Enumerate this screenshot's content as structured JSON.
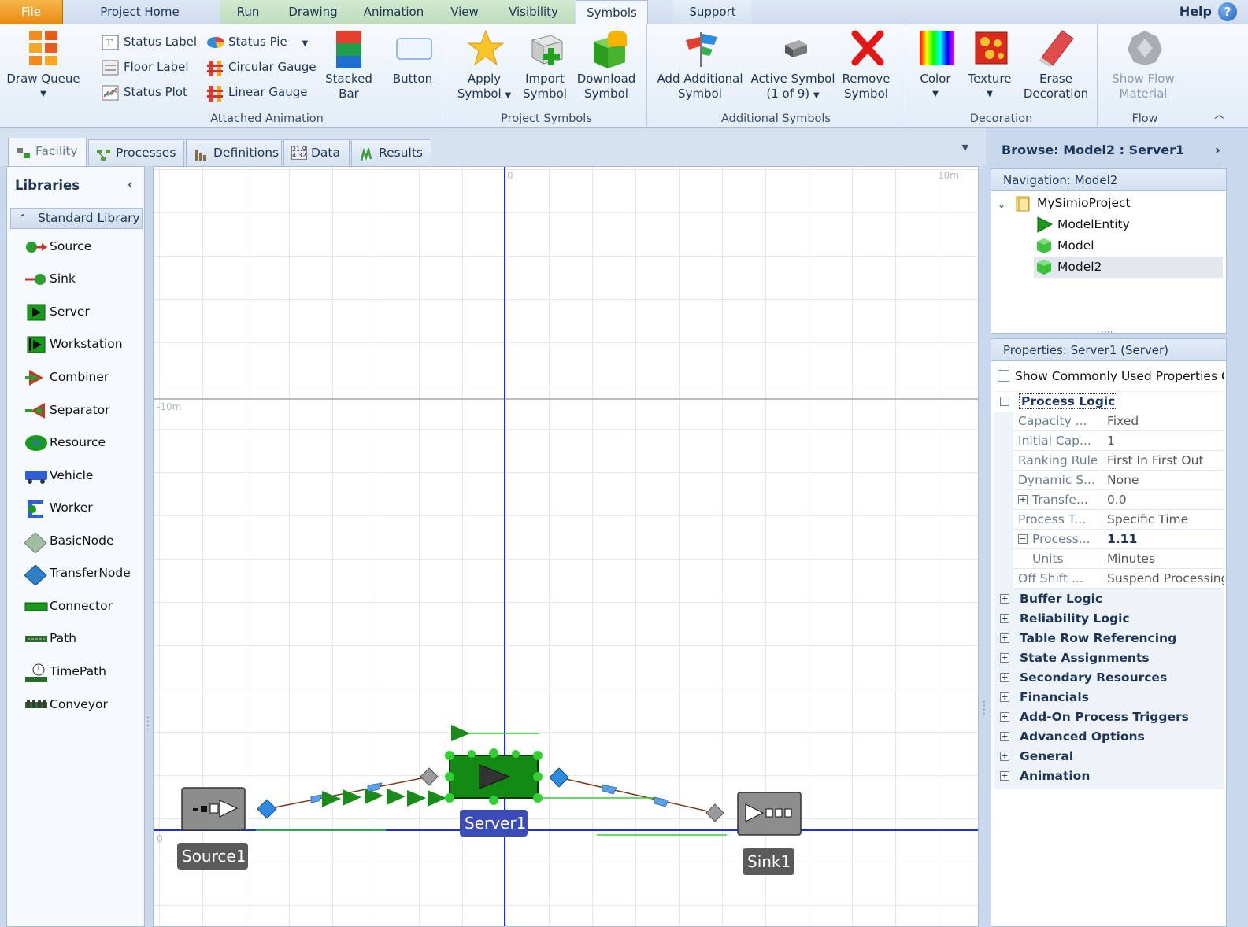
{
  "menu": {
    "file": "File",
    "tabs": [
      "Project Home",
      "Run",
      "Drawing",
      "Animation",
      "View",
      "Visibility",
      "Symbols",
      "Support"
    ],
    "active_tab": "Symbols",
    "help": "Help",
    "help_icon_glyph": "?"
  },
  "ribbon": {
    "draw_queue": {
      "label": "Draw Queue"
    },
    "attached_animation": {
      "label": "Attached Animation",
      "status_label": "Status Label",
      "floor_label": "Floor Label",
      "status_plot": "Status Plot",
      "status_pie": "Status Pie",
      "circular_gauge": "Circular Gauge",
      "linear_gauge": "Linear Gauge",
      "stacked_bar_l1": "Stacked",
      "stacked_bar_l2": "Bar",
      "button": "Button"
    },
    "project_symbols": {
      "label": "Project Symbols",
      "apply_l1": "Apply",
      "apply_l2": "Symbol",
      "import_l1": "Import",
      "import_l2": "Symbol",
      "download_l1": "Download",
      "download_l2": "Symbol"
    },
    "additional_symbols": {
      "label": "Additional Symbols",
      "add_l1": "Add Additional",
      "add_l2": "Symbol",
      "active_l1": "Active Symbol",
      "active_l2": "(1 of 9)",
      "remove_l1": "Remove",
      "remove_l2": "Symbol"
    },
    "decoration": {
      "label": "Decoration",
      "color": "Color",
      "texture": "Texture",
      "erase_l1": "Erase",
      "erase_l2": "Decoration"
    },
    "flow": {
      "label": "Flow",
      "show_l1": "Show Flow",
      "show_l2": "Material"
    }
  },
  "viewtabs": [
    "Facility",
    "Processes",
    "Definitions",
    "Data",
    "Results"
  ],
  "viewtab_data_icon": "21.9 4.32",
  "libraries": {
    "title": "Libraries",
    "group": "Standard Library",
    "items": [
      "Source",
      "Sink",
      "Server",
      "Workstation",
      "Combiner",
      "Separator",
      "Resource",
      "Vehicle",
      "Worker",
      "BasicNode",
      "TransferNode",
      "Connector",
      "Path",
      "TimePath",
      "Conveyor"
    ]
  },
  "canvas": {
    "ruler_top_zero": "0",
    "ruler_top_right": "10m",
    "ruler_left_mid": "-10m",
    "ruler_left_zero": "0",
    "objects": {
      "source": "Source1",
      "server": "Server1",
      "sink": "Sink1"
    }
  },
  "browse": {
    "title": "Browse: Model2 : Server1",
    "navigation_header": "Navigation: Model2",
    "tree": [
      "MySimioProject",
      "ModelEntity",
      "Model",
      "Model2"
    ],
    "selected": "Model2"
  },
  "properties": {
    "header": "Properties: Server1 (Server)",
    "toggle": "Show Commonly Used Properties On",
    "process_logic": "Process Logic",
    "rows": [
      {
        "name": "Capacity ...",
        "value": "Fixed"
      },
      {
        "name": "Initial Cap...",
        "value": "1"
      },
      {
        "name": "Ranking Rule",
        "value": "First In First Out"
      },
      {
        "name": "Dynamic S...",
        "value": "None"
      },
      {
        "name": "Transfe...",
        "value": "0.0"
      },
      {
        "name": "Process T...",
        "value": "Specific Time"
      },
      {
        "name": "Process...",
        "value": "1.11"
      },
      {
        "name": "Units",
        "value": "Minutes"
      },
      {
        "name": "Off Shift ...",
        "value": "Suspend Processing"
      }
    ],
    "categories": [
      "Buffer Logic",
      "Reliability Logic",
      "Table Row Referencing",
      "State Assignments",
      "Secondary Resources",
      "Financials",
      "Add-On Process Triggers",
      "Advanced Options",
      "General",
      "Animation"
    ]
  },
  "colors": {
    "file_tab": "#e88a12",
    "context_tabs": "#bcdcbc",
    "axis_blue": "#1d2fcf",
    "server_green": "#138a13",
    "label_blue": "#3b4bb8",
    "label_gray": "#5a5a5a"
  }
}
